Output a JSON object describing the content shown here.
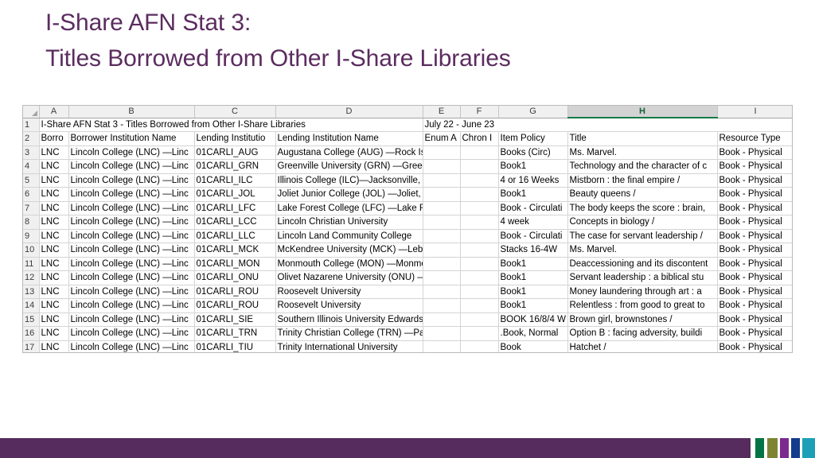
{
  "slide": {
    "title_line1": "I-Share AFN Stat 3:",
    "title_line2": "Titles Borrowed from Other I-Share Libraries",
    "title_color": "#5b2c5f",
    "footer_color": "#562c5e"
  },
  "footer": {
    "stripes": [
      {
        "name": "stripe-white",
        "color": "#ffffff",
        "width": 6
      },
      {
        "name": "stripe-green",
        "color": "#027345",
        "width": 11
      },
      {
        "name": "stripe-white-2",
        "color": "#ffffff",
        "width": 4
      },
      {
        "name": "stripe-olive",
        "color": "#7f8434",
        "width": 13
      },
      {
        "name": "stripe-white-3",
        "color": "#ffffff",
        "width": 3
      },
      {
        "name": "stripe-magenta",
        "color": "#7c2a8e",
        "width": 11
      },
      {
        "name": "stripe-white-4",
        "color": "#ffffff",
        "width": 3
      },
      {
        "name": "stripe-navy",
        "color": "#143c8c",
        "width": 11
      },
      {
        "name": "stripe-white-5",
        "color": "#ffffff",
        "width": 3
      },
      {
        "name": "stripe-teal",
        "color": "#1d9fb8",
        "width": 16
      }
    ]
  },
  "spreadsheet": {
    "selected_column": "H",
    "column_letters": [
      "A",
      "B",
      "C",
      "D",
      "E",
      "F",
      "G",
      "H",
      "I"
    ],
    "row_numbers": [
      "1",
      "2",
      "3",
      "4",
      "5",
      "6",
      "7",
      "8",
      "9",
      "10",
      "11",
      "12",
      "13",
      "14",
      "15",
      "16",
      "17"
    ],
    "banner_row": {
      "row_number": "1",
      "text": "I-Share AFN Stat 3 - Titles Borrowed from Other I-Share Libraries",
      "date_range": "July 22 - June 23"
    },
    "header_row": {
      "row_number": "2",
      "cells": [
        "Borro",
        "Borrower Institution Name",
        "Lending Institutio",
        "Lending Institution Name",
        "Enum A",
        "Chron I",
        "Item Policy",
        "Title",
        "Resource Type"
      ]
    },
    "rows": [
      {
        "n": "3",
        "a": "LNC",
        "b": "Lincoln College (LNC) —Linc",
        "c": "01CARLI_AUG",
        "d": "Augustana College (AUG) —Rock Island, IL",
        "e": "",
        "f": "",
        "g": "Books (Circ)",
        "h": "Ms. Marvel.",
        "i": "Book - Physical"
      },
      {
        "n": "4",
        "a": "LNC",
        "b": "Lincoln College (LNC) —Linc",
        "c": "01CARLI_GRN",
        "d": "Greenville University (GRN) —Greenville, IL",
        "e": "",
        "f": "",
        "g": "Book1",
        "h": "Technology and the character of c",
        "i": "Book - Physical"
      },
      {
        "n": "5",
        "a": "LNC",
        "b": "Lincoln College (LNC) —Linc",
        "c": "01CARLI_ILC",
        "d": "Illinois College (ILC)—Jacksonville, IL",
        "e": "",
        "f": "",
        "g": "4 or 16 Weeks",
        "h": "Mistborn : the final empire /",
        "i": "Book - Physical"
      },
      {
        "n": "6",
        "a": "LNC",
        "b": "Lincoln College (LNC) —Linc",
        "c": "01CARLI_JOL",
        "d": "Joliet Junior College (JOL) —Joliet, IL",
        "e": "",
        "f": "",
        "g": "Book1",
        "h": "Beauty queens /",
        "i": "Book - Physical"
      },
      {
        "n": "7",
        "a": "LNC",
        "b": "Lincoln College (LNC) —Linc",
        "c": "01CARLI_LFC",
        "d": "Lake Forest College (LFC) —Lake Forest, IL",
        "e": "",
        "f": "",
        "g": "Book - Circulati",
        "h": "The body keeps the score : brain,",
        "i": "Book - Physical"
      },
      {
        "n": "8",
        "a": "LNC",
        "b": "Lincoln College (LNC) —Linc",
        "c": "01CARLI_LCC",
        "d": "Lincoln Christian University",
        "e": "",
        "f": "",
        "g": "4 week",
        "h": "Concepts in biology /",
        "i": "Book - Physical"
      },
      {
        "n": "9",
        "a": "LNC",
        "b": "Lincoln College (LNC) —Linc",
        "c": "01CARLI_LLC",
        "d": "Lincoln Land Community College",
        "e": "",
        "f": "",
        "g": "Book - Circulati",
        "h": "The case for servant leadership /",
        "i": "Book - Physical"
      },
      {
        "n": "10",
        "a": "LNC",
        "b": "Lincoln College (LNC) —Linc",
        "c": "01CARLI_MCK",
        "d": "McKendree University (MCK) —Lebanon, IL",
        "e": "",
        "f": "",
        "g": "Stacks 16-4W",
        "h": "Ms. Marvel.",
        "i": "Book - Physical"
      },
      {
        "n": "11",
        "a": "LNC",
        "b": "Lincoln College (LNC) —Linc",
        "c": "01CARLI_MON",
        "d": "Monmouth College (MON) —Monmouth, IL",
        "e": "",
        "f": "",
        "g": "Book1",
        "h": "Deaccessioning and its discontent",
        "i": "Book - Physical"
      },
      {
        "n": "12",
        "a": "LNC",
        "b": "Lincoln College (LNC) —Linc",
        "c": "01CARLI_ONU",
        "d": "Olivet Nazarene University (ONU) —Bourbonnais",
        "e": "",
        "f": "",
        "g": "Book1",
        "h": "Servant leadership : a biblical stu",
        "i": "Book - Physical"
      },
      {
        "n": "13",
        "a": "LNC",
        "b": "Lincoln College (LNC) —Linc",
        "c": "01CARLI_ROU",
        "d": "Roosevelt University",
        "e": "",
        "f": "",
        "g": "Book1",
        "h": "Money laundering through art  : a",
        "i": "Book - Physical"
      },
      {
        "n": "14",
        "a": "LNC",
        "b": "Lincoln College (LNC) —Linc",
        "c": "01CARLI_ROU",
        "d": "Roosevelt University",
        "e": "",
        "f": "",
        "g": "Book1",
        "h": "Relentless : from good to great to",
        "i": "Book - Physical"
      },
      {
        "n": "15",
        "a": "LNC",
        "b": "Lincoln College (LNC) —Linc",
        "c": "01CARLI_SIE",
        "d": "Southern Illinois University Edwardsville (SIE) —E",
        "e": "",
        "f": "",
        "g": "BOOK 16/8/4 W",
        "h": "Brown girl, brownstones /",
        "i": "Book - Physical"
      },
      {
        "n": "16",
        "a": "LNC",
        "b": "Lincoln College (LNC) —Linc",
        "c": "01CARLI_TRN",
        "d": "Trinity Christian College (TRN) —Palos Heights, IL",
        "e": "",
        "f": "",
        "g": ".Book, Normal",
        "h": "Option B : facing adversity, buildi",
        "i": "Book - Physical"
      },
      {
        "n": "17",
        "a": "LNC",
        "b": "Lincoln College (LNC) —Linc",
        "c": "01CARLI_TIU",
        "d": "Trinity International University",
        "e": "",
        "f": "",
        "g": "Book",
        "h": "Hatchet /",
        "i": "Book - Physical"
      }
    ]
  }
}
